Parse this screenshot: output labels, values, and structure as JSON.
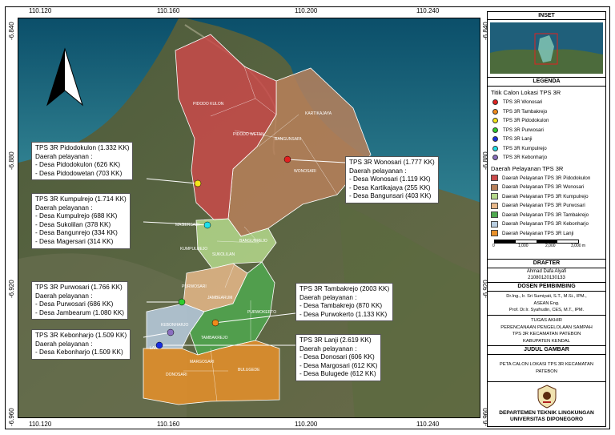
{
  "coords": {
    "top_lon": [
      "110.120",
      "110.160",
      "110.200",
      "110.240"
    ],
    "bottom_lon": [
      "110.120",
      "110.160",
      "110.200",
      "110.240"
    ],
    "left_lat": [
      "-6.840",
      "-6.880",
      "-6.920",
      "-6.960"
    ],
    "right_lat": [
      "-6.840",
      "-6.880",
      "-6.920",
      "-6.960"
    ]
  },
  "villages": {
    "pidodokulon": "PIDODO KULON",
    "pidodowetan": "PIDODO WETAN",
    "bangunsari": "BANGUNSARI",
    "kartikajaya": "KARTIKAJAYA",
    "wonosari": "WONOSARI",
    "magersari": "MAGERSARI",
    "bangunrejo": "BANGUNREJO",
    "kumpulrejo": "KUMPULREJO",
    "sukolilan": "SUKOLILAN",
    "purwosari": "PURWOSARI",
    "jambearum": "JAMBEARUM",
    "purwokerto": "PURWOKERTO",
    "kebonharjo": "KEBONHARJO",
    "tambakrejo": "TAMBAKREJO",
    "lanji": "LANJI",
    "margosari": "MARGOSARI",
    "donosari": "DONOSARI",
    "bulugede": "BULUGEDE"
  },
  "callouts": {
    "pidodokulon": {
      "title": "TPS 3R Pidodokulon (1.332 KK)",
      "sub": "Daerah pelayanan :",
      "lines": [
        "- Desa Pidodokulon (626 KK)",
        "- Desa Pidodowetan (703 KK)"
      ]
    },
    "wonosari": {
      "title": "TPS 3R Wonosari (1.777 KK)",
      "sub": "Daerah pelayanan :",
      "lines": [
        "- Desa Wonosari (1.119 KK)",
        "- Desa Kartikajaya (255 KK)",
        "- Desa Bangunsari (403 KK)"
      ]
    },
    "kumpulrejo": {
      "title": "TPS 3R Kumpulrejo (1.714 KK)",
      "sub": "Daerah pelayanan :",
      "lines": [
        "- Desa Kumpulrejo (688 KK)",
        "- Desa Sukolilan (378 KK)",
        "- Desa Bangunrejo (334 KK)",
        "- Desa Magersari (314 KK)"
      ]
    },
    "purwosari": {
      "title": "TPS 3R Purwosari (1.766 KK)",
      "sub": "Daerah pelayanan :",
      "lines": [
        "- Desa Purwosari (686 KK)",
        "- Desa Jambearum (1.080 KK)"
      ]
    },
    "tambakrejo": {
      "title": "TPS 3R Tambakrejo (2003 KK)",
      "sub": "Daerah pelayanan :",
      "lines": [
        "- Desa Tambakrejo (870 KK)",
        "- Desa Purwokerto (1.133 KK)"
      ]
    },
    "kebonharjo": {
      "title": "TPS 3R Kebonharjo (1.509 KK)",
      "sub": "Daerah pelayanan :",
      "lines": [
        "- Desa Kebonharjo (1.509 KK)"
      ]
    },
    "lanji": {
      "title": "TPS 3R Lanji (2.619 KK)",
      "sub": "Daerah pelayanan :",
      "lines": [
        "- Desa Donosari (606 KK)",
        "- Desa Margosari (612 KK)",
        "- Desa Bulugede (612 KK)"
      ]
    }
  },
  "panel": {
    "inset_title": "INSET",
    "legend_title": "LEGENDA",
    "points_title": "Titik Calon Lokasi TPS 3R",
    "points": [
      {
        "label": "TPS 3R Wonosari",
        "color": "#e02020"
      },
      {
        "label": "TPS 3R Tambakrejo",
        "color": "#f08a1a"
      },
      {
        "label": "TPS 3R Pidodokulon",
        "color": "#f5e51a"
      },
      {
        "label": "TPS 3R Purwosari",
        "color": "#2ecc2e"
      },
      {
        "label": "TPS 3R Lanji",
        "color": "#1a2ee0"
      },
      {
        "label": "TPS 3R Kumpulrejo",
        "color": "#20e0e8"
      },
      {
        "label": "TPS 3R Kebonharjo",
        "color": "#8a6fc0"
      }
    ],
    "areas_title": "Daerah Pelayanan TPS 3R",
    "areas": [
      {
        "label": "Daerah Pelayanan TPS 3R Pidodokulon",
        "color": "#c94a4a"
      },
      {
        "label": "Daerah Pelayanan TPS 3R Wonosari",
        "color": "#b8805a"
      },
      {
        "label": "Daerah Pelayanan TPS 3R Kumpulrejo",
        "color": "#b5d98c"
      },
      {
        "label": "Daerah Pelayanan TPS 3R Purwosari",
        "color": "#e8b88a"
      },
      {
        "label": "Daerah Pelayanan TPS 3R Tambakrejo",
        "color": "#4fa84f"
      },
      {
        "label": "Daerah Pelayanan TPS 3R Kebonharjo",
        "color": "#b8cde0"
      },
      {
        "label": "Daerah Pelayanan TPS 3R Lanji",
        "color": "#e8902a"
      }
    ],
    "scale": [
      "0",
      "1,000",
      "2,000",
      "3,000 m"
    ],
    "drafter_title": "DRAFTER",
    "drafter_name": "Ahmad Dafa Alyafi",
    "drafter_nim": "21080120130133",
    "dosen_title": "DOSEN PEMBIMBING",
    "dosen_lines": [
      "Dr.Ing., Ir. Sri Sumiyati, S.T., M.Si., IPM.,",
      "ASEAN Eng.",
      "Prof. Dr.Ir. Syafrudin, CES, M.T., IPM."
    ],
    "ta_lines": [
      "TUGAS AKHIR",
      "PERENCANAAN PENGELOLAAN SAMPAH",
      "TPS 3R KECAMATAN PATEBON",
      "KABUPATEN KENDAL"
    ],
    "judul_title": "JUDUL GAMBAR",
    "judul_lines": [
      "PETA CALON LOKASI TPS 3R KECAMATAN",
      "PATEBON"
    ],
    "dept_lines": [
      "DEPARTEMEN TEKNIK LINGKUNGAN",
      "UNIVERSITAS DIPONEGORO"
    ]
  }
}
